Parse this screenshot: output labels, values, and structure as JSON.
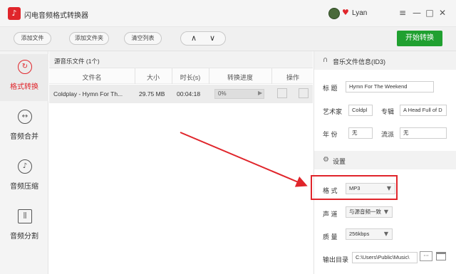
{
  "window": {
    "title": "闪电音频格式转换器",
    "username": "Lyan",
    "logo_glyph": "♪",
    "heart_glyph": "♥",
    "minimize_glyph": "—",
    "menu_glyph": "≡",
    "maximize_glyph": "□",
    "close_glyph": "✕"
  },
  "toolbar": {
    "add_file": "添加文件",
    "add_folder": "添加文件夹",
    "clear_list": "清空列表",
    "up_glyph": "∧",
    "down_glyph": "∨",
    "start": "开始转换"
  },
  "sidebar": {
    "items": [
      {
        "label": "格式转换",
        "icon": "refresh-icon",
        "glyph": "↻",
        "active": true
      },
      {
        "label": "音频合并",
        "icon": "merge-icon",
        "glyph": "↔",
        "active": false
      },
      {
        "label": "音频压缩",
        "icon": "compress-icon",
        "glyph": "♪",
        "active": false
      },
      {
        "label": "音频分割",
        "icon": "split-icon",
        "glyph": "⫼",
        "active": false
      }
    ]
  },
  "filelist": {
    "title": "源音乐文件 (1个)",
    "columns": [
      "文件名",
      "大小",
      "时长(s)",
      "转换进度",
      "操作"
    ],
    "rows": [
      {
        "name": "Coldplay - Hymn For Th...",
        "size": "29.75 MB",
        "duration": "00:04:18",
        "progress": "0%",
        "progress_value": 0
      }
    ]
  },
  "id3": {
    "section_title": "音乐文件信息(ID3)",
    "title_label": "标  题",
    "title_value": "Hymn For The Weekend",
    "artist_label": "艺术家",
    "artist_value": "Coldpl",
    "album_label": "专辑",
    "album_value": "A Head Full of D",
    "year_label": "年  份",
    "year_value": "无",
    "genre_label": "流派",
    "genre_value": "无"
  },
  "settings": {
    "section_title": "设置",
    "format_label": "格  式",
    "format_value": "MP3",
    "channel_label": "声  道",
    "channel_value": "与源音频一致",
    "quality_label": "质  量",
    "quality_value": "256kbps",
    "output_label": "输出目录",
    "output_value": "C:\\Users\\Public\\Music\\",
    "dots": "···"
  },
  "colors": {
    "accent": "#e0252b",
    "start_button": "#20a030",
    "annotation": "#e0252b"
  }
}
